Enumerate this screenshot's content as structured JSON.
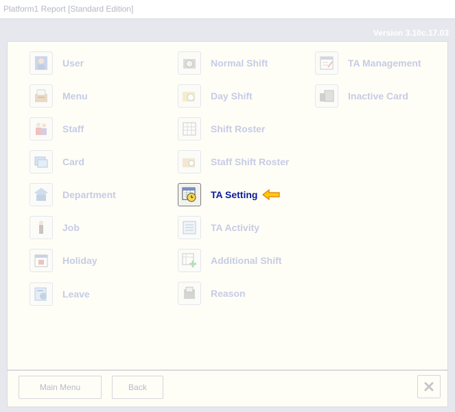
{
  "window": {
    "title": "Platform1 Report [Standard Edition]"
  },
  "version": "Version 3.10c.17.03",
  "menu": {
    "column1": [
      {
        "label": "User",
        "icon": "user-icon"
      },
      {
        "label": "Menu",
        "icon": "menu-icon"
      },
      {
        "label": "Staff",
        "icon": "staff-icon"
      },
      {
        "label": "Card",
        "icon": "card-icon"
      },
      {
        "label": "Department",
        "icon": "department-icon"
      },
      {
        "label": "Job",
        "icon": "job-icon"
      },
      {
        "label": "Holiday",
        "icon": "holiday-icon"
      },
      {
        "label": "Leave",
        "icon": "leave-icon"
      }
    ],
    "column2": [
      {
        "label": "Normal Shift",
        "icon": "normal-shift-icon"
      },
      {
        "label": "Day Shift",
        "icon": "day-shift-icon"
      },
      {
        "label": "Shift Roster",
        "icon": "shift-roster-icon"
      },
      {
        "label": "Staff Shift Roster",
        "icon": "staff-shift-roster-icon"
      },
      {
        "label": "TA Setting",
        "icon": "ta-setting-icon",
        "active": true
      },
      {
        "label": "TA Activity",
        "icon": "ta-activity-icon"
      },
      {
        "label": "Additional Shift",
        "icon": "additional-shift-icon"
      },
      {
        "label": "Reason",
        "icon": "reason-icon"
      }
    ],
    "column3": [
      {
        "label": "TA Management",
        "icon": "ta-management-icon"
      },
      {
        "label": "Inactive Card",
        "icon": "inactive-card-icon"
      }
    ]
  },
  "footer": {
    "main_menu": "Main Menu",
    "back": "Back",
    "close_icon": "close-icon"
  },
  "colors": {
    "active_label": "#0a1a9c",
    "disabled_label": "#c6cbe6",
    "pointer": "#ffcc00"
  }
}
